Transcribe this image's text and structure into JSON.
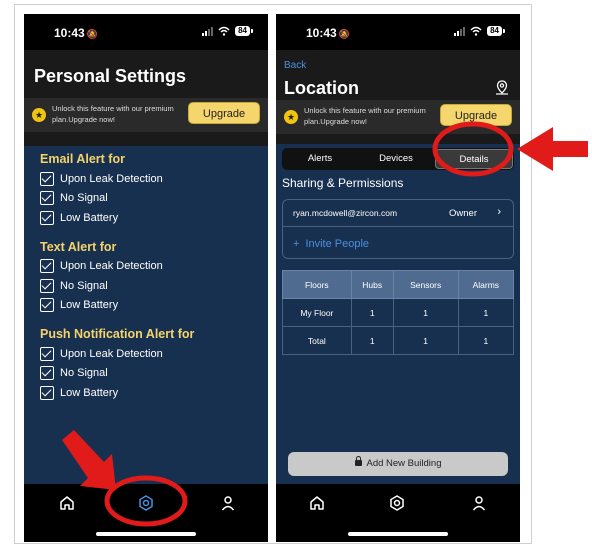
{
  "status_bar": {
    "time": "10:43",
    "battery": "84"
  },
  "left_screen": {
    "title": "Personal Settings",
    "upgrade_text": "Unlock this feature with our premium plan.Upgrade now!",
    "upgrade_button": "Upgrade",
    "sections": [
      {
        "title": "Email Alert for",
        "items": [
          "Upon Leak Detection",
          "No Signal",
          "Low Battery"
        ]
      },
      {
        "title": "Text Alert for",
        "items": [
          "Upon Leak Detection",
          "No Signal",
          "Low Battery"
        ]
      },
      {
        "title": "Push Notification Alert for",
        "items": [
          "Upon Leak Detection",
          "No Signal",
          "Low Battery"
        ]
      }
    ]
  },
  "right_screen": {
    "back": "Back",
    "title": "Location",
    "upgrade_text": "Unlock this feature with our premium plan.Upgrade now!",
    "upgrade_button": "Upgrade",
    "tabs": [
      "Alerts",
      "Devices",
      "Details"
    ],
    "sharing_title": "Sharing & Permissions",
    "share_email": "ryan.mcdowell@zircon.com",
    "share_role": "Owner",
    "invite_label": "Invite People",
    "table": {
      "headers": [
        "Floors",
        "Hubs",
        "Sensors",
        "Alarms"
      ],
      "rows": [
        [
          "My Floor",
          "1",
          "1",
          "1"
        ],
        [
          "Total",
          "1",
          "1",
          "1"
        ]
      ]
    },
    "add_building": "Add New Building"
  },
  "colors": {
    "content_bg": "#18304f",
    "section_title": "#f4d36b",
    "upgrade_button": "#f5d66d",
    "link": "#4b8fe0",
    "highlight": "#e11a1a"
  },
  "icons": {
    "nav": [
      "home-icon",
      "settings-gear-icon",
      "person-icon"
    ],
    "annotations": [
      "red-circle-highlight",
      "red-arrow-pointer"
    ]
  }
}
